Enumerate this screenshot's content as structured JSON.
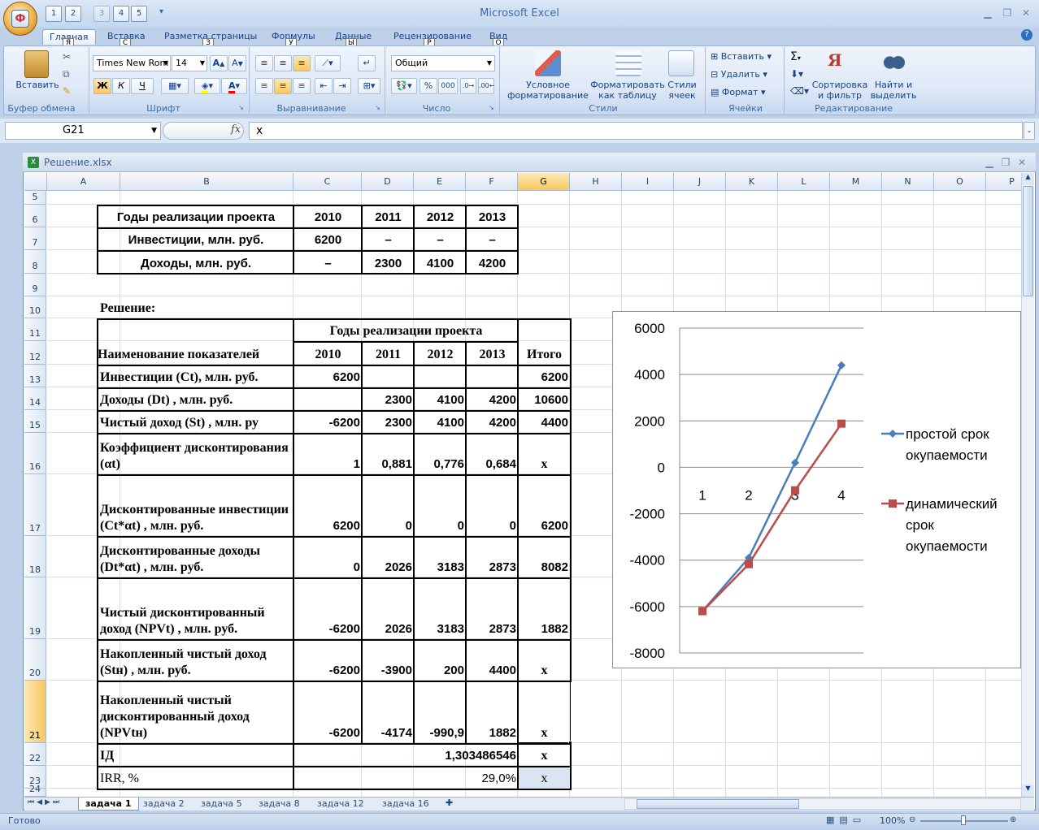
{
  "app": {
    "title": "Microsoft Excel"
  },
  "qat": {
    "keys": [
      "1",
      "2",
      "3",
      "4",
      "5"
    ]
  },
  "tabs": [
    {
      "label": "Главная",
      "key": "Я"
    },
    {
      "label": "Вставка",
      "key": "С"
    },
    {
      "label": "Разметка страницы",
      "key": "З"
    },
    {
      "label": "Формулы",
      "key": "У"
    },
    {
      "label": "Данные",
      "key": "Ы"
    },
    {
      "label": "Рецензирование",
      "key": "Р"
    },
    {
      "label": "Вид",
      "key": "О"
    }
  ],
  "ribbon": {
    "clipboard": {
      "paste": "Вставить",
      "label": "Буфер обмена"
    },
    "font": {
      "name": "Times New Rom",
      "size": "14",
      "bold": "Ж",
      "italic": "К",
      "underline": "Ч",
      "label": "Шрифт"
    },
    "align": {
      "label": "Выравнивание"
    },
    "number": {
      "format": "Общий",
      "pct": "%",
      "thousands": "000",
      "label": "Число"
    },
    "styles": {
      "cond": "Условное форматирование",
      "table": "Форматировать как таблицу",
      "cell": "Стили ячеек",
      "label": "Стили"
    },
    "cells": {
      "insert": "Вставить",
      "delete": "Удалить",
      "format": "Формат",
      "label": "Ячейки"
    },
    "editing": {
      "sum": "Σ",
      "sort": "Сортировка и фильтр",
      "find": "Найти и выделить",
      "label": "Редактирование"
    }
  },
  "formula_bar": {
    "name_box": "G21",
    "fx": "fx",
    "content": "x"
  },
  "workbook": {
    "title": "Решение.xlsx"
  },
  "columns": [
    "A",
    "B",
    "C",
    "D",
    "E",
    "F",
    "G",
    "H",
    "I",
    "J",
    "K",
    "L",
    "M",
    "N",
    "O",
    "P"
  ],
  "rows": [
    "5",
    "6",
    "7",
    "8",
    "9",
    "10",
    "11",
    "12",
    "13",
    "14",
    "15",
    "16",
    "17",
    "18",
    "19",
    "20",
    "21",
    "22",
    "23",
    "24"
  ],
  "table1": {
    "header": [
      "Годы реализации проекта",
      "2010",
      "2011",
      "2012",
      "2013"
    ],
    "rows": [
      [
        "Инвестиции, млн. руб.",
        "6200",
        "–",
        "–",
        "–"
      ],
      [
        "Доходы, млн. руб.",
        "–",
        "2300",
        "4100",
        "4200"
      ]
    ]
  },
  "solution_label": "Решение:",
  "table2": {
    "years_header": "Годы реализации проекта",
    "name_header": "Наименование показателей",
    "years": [
      "2010",
      "2011",
      "2012",
      "2013"
    ],
    "total_header": "Итого",
    "rows": [
      [
        "Инвестиции (Ct), млн. руб.",
        "6200",
        "",
        "",
        "",
        "6200"
      ],
      [
        "Доходы (Dt) , млн. руб.",
        "",
        "2300",
        "4100",
        "4200",
        "10600"
      ],
      [
        "Чистый доход (St) , млн. ру",
        "-6200",
        "2300",
        "4100",
        "4200",
        "4400"
      ],
      [
        "Коэффициент дисконтирования (αt)",
        "1",
        "0,881",
        "0,776",
        "0,684",
        "x"
      ],
      [
        "Дисконтированные инвестиции (Ct*αt) , млн. руб.",
        "6200",
        "0",
        "0",
        "0",
        "6200"
      ],
      [
        "Дисконтированные доходы (Dt*αt) , млн. руб.",
        "0",
        "2026",
        "3183",
        "2873",
        "8082"
      ],
      [
        "Чистый дисконтированный доход (NPVt) , млн. руб.",
        "-6200",
        "2026",
        "3183",
        "2873",
        "1882"
      ],
      [
        "Накопленный чистый доход (Stн) , млн. руб.",
        "-6200",
        "-3900",
        "200",
        "4400",
        "x"
      ],
      [
        "Накопленный чистый дисконтированный доход (NPVtн)",
        "-6200",
        "-4174",
        "-990,9",
        "1882",
        "x"
      ]
    ],
    "id_label": "IД",
    "id_value": "1,303486546",
    "id_total": "x",
    "irr_label": "IRR, %",
    "irr_value": "29,0%",
    "irr_total": "x"
  },
  "chart_data": {
    "type": "line",
    "x": [
      "1",
      "2",
      "3",
      "4"
    ],
    "ylim": [
      -8000,
      6000
    ],
    "yticks": [
      "6000",
      "4000",
      "2000",
      "0",
      "-2000",
      "-4000",
      "-6000",
      "-8000"
    ],
    "legend_position": "right",
    "series": [
      {
        "name": "простой срок окупаемости",
        "values": [
          -6200,
          -3900,
          200,
          4400
        ],
        "color": "#4a7ebb",
        "marker": "diamond"
      },
      {
        "name": "динамический срок окупаемости",
        "values": [
          -6200,
          -4174,
          -990.9,
          1882
        ],
        "color": "#be4b48",
        "marker": "square"
      }
    ]
  },
  "sheet_tabs": [
    "задача 1",
    "задача 2",
    "задача 5",
    "задача 8",
    "задача 12",
    "задача 16"
  ],
  "status": {
    "ready": "Готово",
    "zoom": "100%"
  }
}
